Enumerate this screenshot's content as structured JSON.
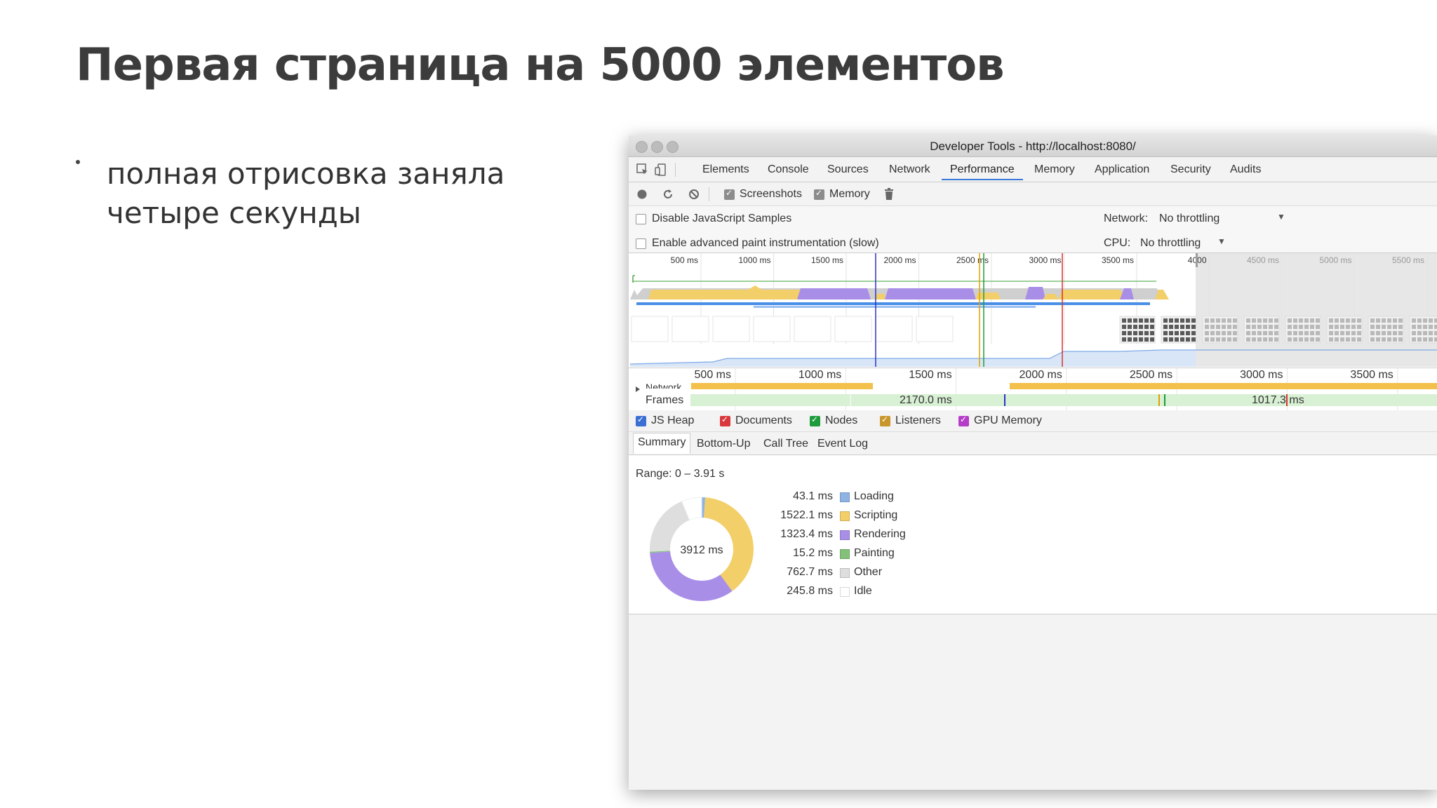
{
  "slide": {
    "title": "Первая страница на 5000 элементов",
    "bullets": [
      {
        "lines": [
          "полная отрисовка заняла",
          "четыре секунды"
        ]
      }
    ]
  },
  "devtools": {
    "window_title": "Developer Tools - http://localhost:8080/",
    "tabs": [
      "Elements",
      "Console",
      "Sources",
      "Network",
      "Performance",
      "Memory",
      "Application",
      "Security",
      "Audits"
    ],
    "active_tab": "Performance",
    "toolbar": {
      "screenshots_label": "Screenshots",
      "screenshots_checked": true,
      "memory_label": "Memory",
      "memory_checked": true
    },
    "settings": {
      "disable_js_samples": "Disable JavaScript Samples",
      "advanced_paint": "Enable advanced paint instrumentation (slow)",
      "network_label": "Network:",
      "network_value": "No throttling",
      "cpu_label": "CPU:",
      "cpu_value": "No throttling"
    },
    "overview_ticks": [
      "500 ms",
      "1000 ms",
      "1500 ms",
      "2000 ms",
      "2500 ms",
      "3000 ms",
      "3500 ms",
      "4000",
      "4500 ms",
      "5000 ms",
      "5500 ms"
    ],
    "timeline_ticks": [
      "500 ms",
      "1000 ms",
      "1500 ms",
      "2000 ms",
      "2500 ms",
      "3000 ms",
      "3500 ms"
    ],
    "network_label": "Network",
    "frames_label": "Frames",
    "frame_values": [
      "2170.0 ms",
      "1017.3 ms"
    ],
    "memory_counters": [
      {
        "label": "JS Heap",
        "color": "#3b6fd3"
      },
      {
        "label": "Documents",
        "color": "#d9383c"
      },
      {
        "label": "Nodes",
        "color": "#1e9b3a"
      },
      {
        "label": "Listeners",
        "color": "#c8962a"
      },
      {
        "label": "GPU Memory",
        "color": "#b43ec8"
      }
    ],
    "subtabs": [
      "Summary",
      "Bottom-Up",
      "Call Tree",
      "Event Log"
    ],
    "active_subtab": "Summary",
    "range": "Range: 0 – 3.91 s",
    "total": "3912 ms",
    "breakdown": [
      {
        "value": "43.1 ms",
        "label": "Loading",
        "color": "#8fb3e3"
      },
      {
        "value": "1522.1 ms",
        "label": "Scripting",
        "color": "#f3cf6a"
      },
      {
        "value": "1323.4 ms",
        "label": "Rendering",
        "color": "#a98ee8"
      },
      {
        "value": "15.2 ms",
        "label": "Painting",
        "color": "#83c17a"
      },
      {
        "value": "762.7 ms",
        "label": "Other",
        "color": "#dedede"
      },
      {
        "value": "245.8 ms",
        "label": "Idle",
        "color": "#ffffff"
      }
    ],
    "breakdown_ms": [
      43.1,
      1522.1,
      1323.4,
      15.2,
      762.7,
      245.8
    ]
  }
}
